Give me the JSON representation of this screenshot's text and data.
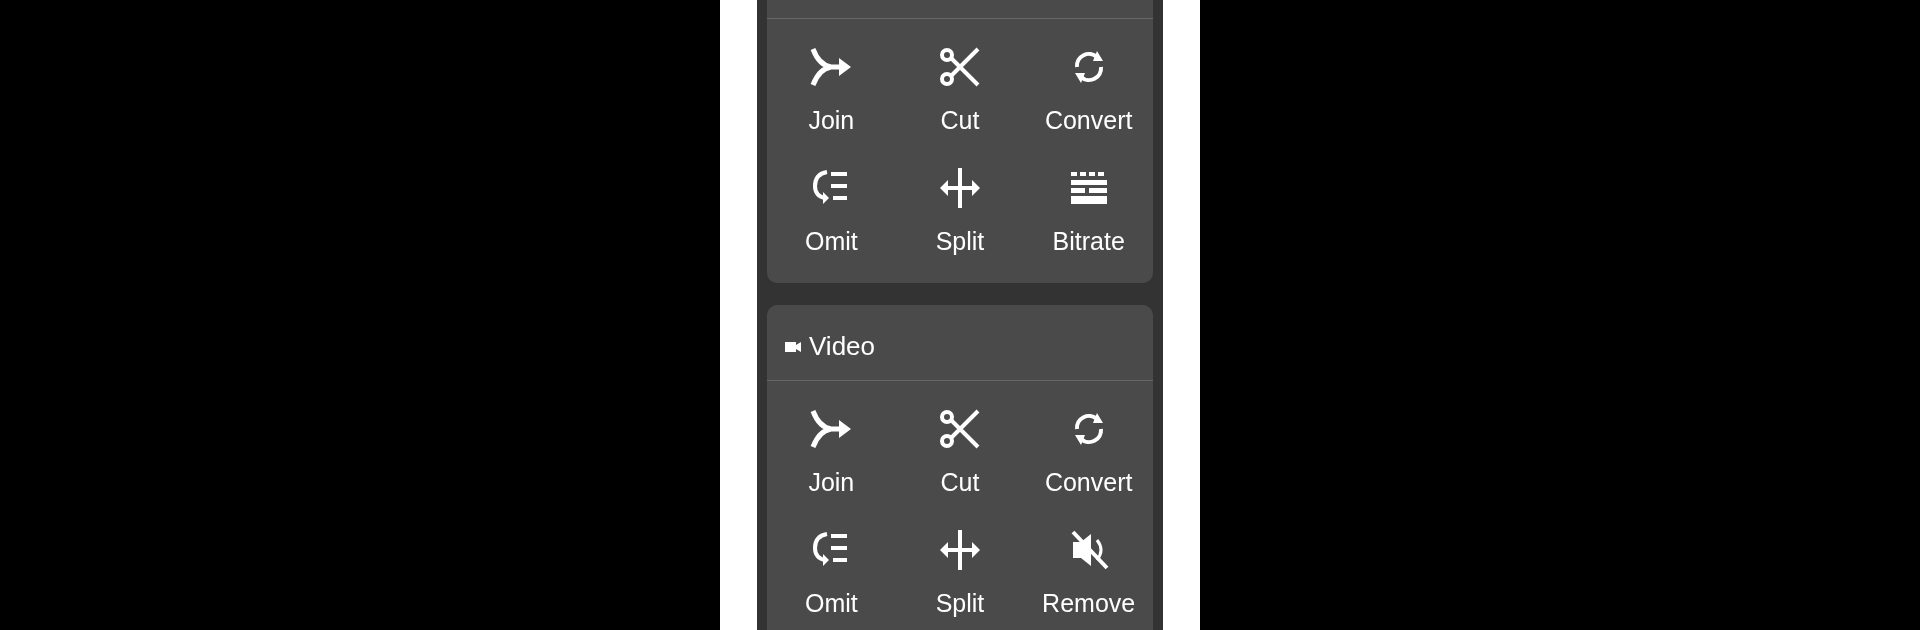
{
  "sections": [
    {
      "items": [
        {
          "kind": "join",
          "label": "Join"
        },
        {
          "kind": "cut",
          "label": "Cut"
        },
        {
          "kind": "convert",
          "label": "Convert"
        },
        {
          "kind": "omit",
          "label": "Omit"
        },
        {
          "kind": "split",
          "label": "Split"
        },
        {
          "kind": "bitrate",
          "label": "Bitrate"
        }
      ]
    },
    {
      "title": "Video",
      "items": [
        {
          "kind": "join",
          "label": "Join"
        },
        {
          "kind": "cut",
          "label": "Cut"
        },
        {
          "kind": "convert",
          "label": "Convert"
        },
        {
          "kind": "omit",
          "label": "Omit"
        },
        {
          "kind": "split",
          "label": "Split"
        },
        {
          "kind": "mute",
          "label": "Remove"
        }
      ]
    }
  ]
}
